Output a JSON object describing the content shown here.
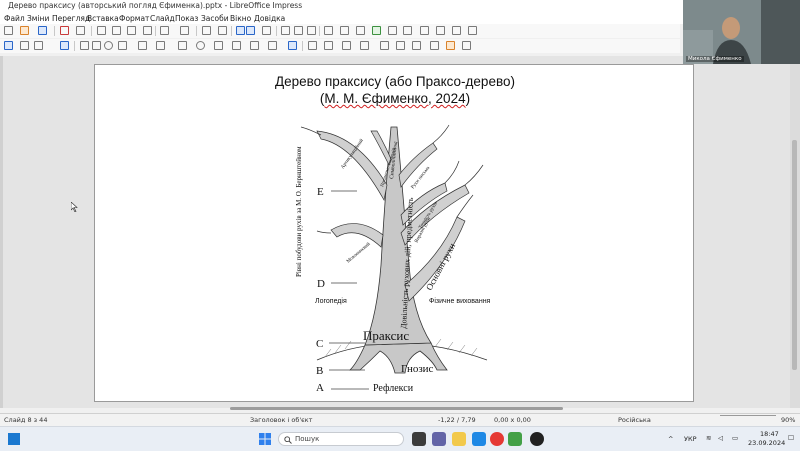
{
  "window": {
    "title": "Дерево праксису (авторський погляд Єфименка).pptx - LibreOffice Impress"
  },
  "menu": [
    "Файл",
    "Зміни",
    "Перегляд",
    "Вставка",
    "Формат",
    "Слайд",
    "Показ",
    "Засоби",
    "Вікно",
    "Довідка"
  ],
  "slide": {
    "title_line1": "Дерево праксису (або Праксо-дерево)",
    "title_line2": "(М. М. Єфименко, 2024)",
    "vertical_caption": "Рівні побудови рухів за М. О. Бернштейном",
    "levels": {
      "E": "E",
      "D": "D",
      "C": "C",
      "B": "B",
      "A": "A"
    },
    "trunk_label": "Довільність рухових дій, предметність",
    "praxis": "Праксис",
    "gnosis": "Гнозис",
    "reflexes": "Рефлекси",
    "logopedia": "Логопедія",
    "phys_ed": "Фізичне виховання",
    "branch_symbolic": "Символічний",
    "branch_articulatory": "Артикуляційний",
    "branch_subject": "Предметно-символічний",
    "branch_speech": "Мовленнєвий",
    "branch_expressive": "Виразні рухи",
    "branch_accuracy": "Точність рухів",
    "branch_handwriting": "Рухи письма",
    "branch_basic": "Основні рухи"
  },
  "status": {
    "slide": "Слайд 8 з 44",
    "layout": "Заголовок і об'єкт",
    "position": "-1,22 / 7,79",
    "size": "0,00 x 0,00",
    "language": "Російська",
    "zoom": "90%"
  },
  "taskbar": {
    "search": "Пошук",
    "lang": "УКР",
    "time": "18:47",
    "date": "23.09.2024"
  },
  "webcam": {
    "name": "Микола Єфименко"
  }
}
